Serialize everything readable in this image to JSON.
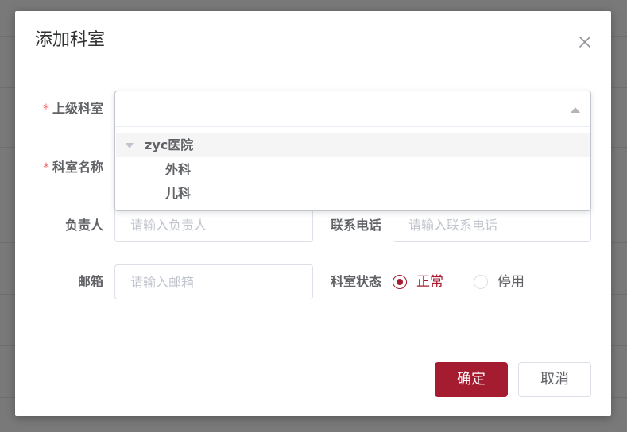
{
  "dialog": {
    "title": "添加科室",
    "close_icon": "close-icon"
  },
  "form": {
    "parent_dept": {
      "required_mark": "*",
      "label": "上级科室",
      "value": "",
      "caret_icon": "caret-up-icon",
      "tree": [
        {
          "label": "zyc医院",
          "expanded": true
        },
        {
          "label": "外科"
        },
        {
          "label": "儿科"
        }
      ]
    },
    "dept_name": {
      "required_mark": "*",
      "label": "科室名称"
    },
    "leader": {
      "label": "负责人",
      "placeholder": "请输入负责人"
    },
    "phone": {
      "label": "联系电话",
      "placeholder": "请输入联系电话"
    },
    "email": {
      "label": "邮箱",
      "placeholder": "请输入邮箱"
    },
    "status": {
      "label": "科室状态",
      "options": [
        {
          "label": "正常",
          "checked": true
        },
        {
          "label": "停用",
          "checked": false
        }
      ]
    }
  },
  "footer": {
    "confirm_label": "确定",
    "cancel_label": "取消"
  },
  "colors": {
    "primary": "#a51c30",
    "required": "#f56c6c"
  }
}
